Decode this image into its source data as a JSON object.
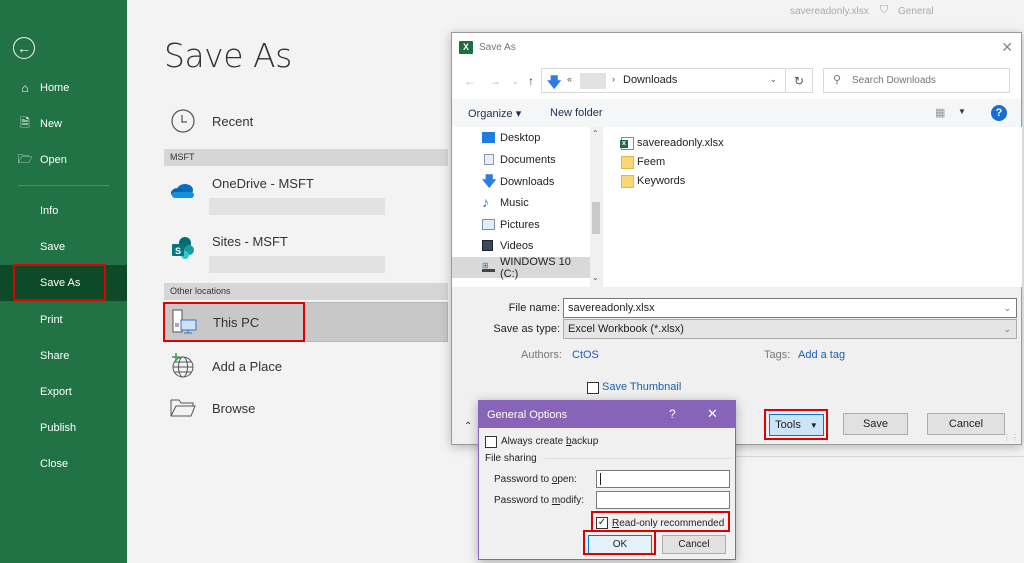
{
  "titlebar": {
    "document_name": "savereadonly.xlsx",
    "sensitivity_label": "General"
  },
  "sidebar": {
    "back_label": "Back",
    "items": [
      {
        "label": "Home",
        "icon": "home-icon"
      },
      {
        "label": "New",
        "icon": "new-document-icon"
      },
      {
        "label": "Open",
        "icon": "open-folder-icon"
      },
      {
        "label": "Info"
      },
      {
        "label": "Save"
      },
      {
        "label": "Save As",
        "active": true
      },
      {
        "label": "Print"
      },
      {
        "label": "Share"
      },
      {
        "label": "Export"
      },
      {
        "label": "Publish"
      },
      {
        "label": "Close"
      }
    ]
  },
  "save_as_panel": {
    "title": "Save As",
    "recent_label": "Recent",
    "sections": [
      {
        "header": "MSFT"
      },
      {
        "header": "Other locations"
      }
    ],
    "locations": {
      "onedrive": "OneDrive - MSFT",
      "sites": "Sites - MSFT",
      "this_pc": "This PC",
      "add_place": "Add a Place",
      "browse": "Browse"
    }
  },
  "dialog": {
    "title": "Save As",
    "address": {
      "crumb_prefix": "«",
      "separator": "›",
      "current": "Downloads"
    },
    "search_placeholder": "Search Downloads",
    "toolbar": {
      "organize": "Organize ▾",
      "new_folder": "New folder"
    },
    "tree": [
      {
        "label": "Desktop"
      },
      {
        "label": "Documents"
      },
      {
        "label": "Downloads"
      },
      {
        "label": "Music"
      },
      {
        "label": "Pictures"
      },
      {
        "label": "Videos"
      },
      {
        "label": "WINDOWS 10 (C:)",
        "selected": true
      }
    ],
    "files": [
      {
        "name": "savereadonly.xlsx",
        "type": "xlsx"
      },
      {
        "name": "Feem",
        "type": "folder"
      },
      {
        "name": "Keywords",
        "type": "folder"
      }
    ],
    "file_name_label": "File name:",
    "file_name_value": "savereadonly.xlsx",
    "save_type_label": "Save as type:",
    "save_type_value": "Excel Workbook (*.xlsx)",
    "authors_label": "Authors:",
    "authors_value": "CtOS",
    "tags_label": "Tags:",
    "tags_value": "Add a tag",
    "save_thumbnail_label": "Save Thumbnail",
    "save_thumbnail_checked": false,
    "tools_label": "Tools",
    "save_label": "Save",
    "cancel_label": "Cancel"
  },
  "general_options": {
    "title": "General Options",
    "help": "?",
    "close": "✕",
    "always_backup_pre": "Always create ",
    "always_backup_u": "b",
    "always_backup_post": "ackup",
    "always_backup_checked": false,
    "file_sharing_label": "File sharing",
    "pwd_open_pre": "Password to ",
    "pwd_open_u": "o",
    "pwd_open_post": "pen:",
    "pwd_open_value": "",
    "pwd_modify_pre": "Password to ",
    "pwd_modify_u": "m",
    "pwd_modify_post": "odify:",
    "pwd_modify_value": "",
    "readonly_u": "R",
    "readonly_post": "ead-only recommended",
    "readonly_checked": true,
    "ok_label": "OK",
    "cancel_label": "Cancel"
  },
  "colors": {
    "excel_green": "#217346",
    "sidebar_active": "#0e4a27",
    "highlight_red": "#e00000",
    "dialog_purple": "#8764b8",
    "link_blue": "#1a5fb4"
  }
}
